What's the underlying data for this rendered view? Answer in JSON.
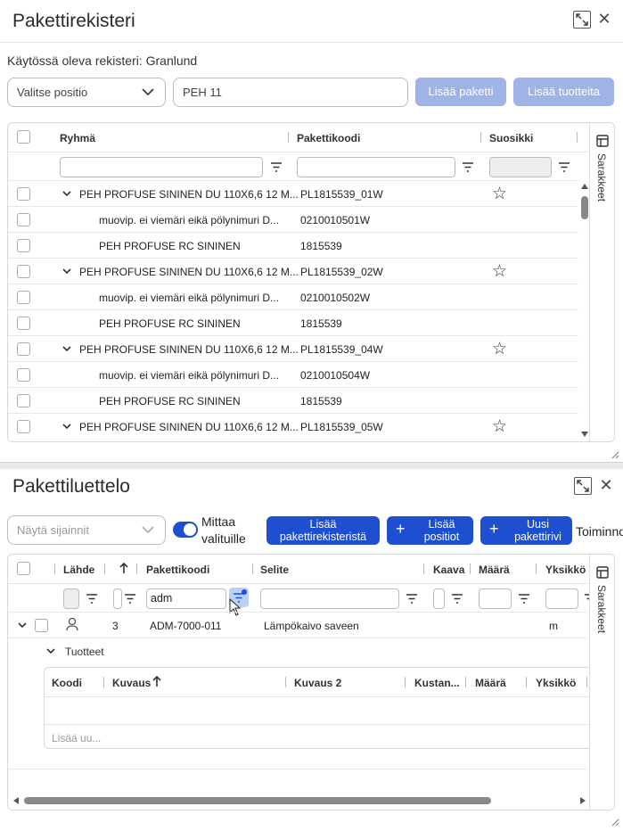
{
  "top_panel": {
    "title": "Pakettirekisteri",
    "register_label": "Käytössä oleva rekisteri: Granlund",
    "position_select_placeholder": "Valitse positio",
    "search_value": "PEH 11",
    "add_package_label": "Lisää paketti",
    "add_products_label": "Lisää tuotteita",
    "side_tab_label": "Sarakkeet",
    "columns": [
      "Ryhmä",
      "Pakettikoodi",
      "Suosikki"
    ],
    "rows": [
      {
        "group": "PEH PROFUSE SININEN DU 110X6,6 12 M...",
        "code": "PL1815539_01W",
        "parent": true
      },
      {
        "group": "muovip. ei viemäri eikä pölynimuri D...",
        "code": "0210010501W",
        "parent": false
      },
      {
        "group": "PEH PROFUSE RC SININEN",
        "code": "1815539",
        "parent": false
      },
      {
        "group": "PEH PROFUSE SININEN DU 110X6,6 12 M...",
        "code": "PL1815539_02W",
        "parent": true
      },
      {
        "group": "muovip. ei viemäri eikä pölynimuri D...",
        "code": "0210010502W",
        "parent": false
      },
      {
        "group": "PEH PROFUSE RC SININEN",
        "code": "1815539",
        "parent": false
      },
      {
        "group": "PEH PROFUSE SININEN DU 110X6,6 12 M...",
        "code": "PL1815539_04W",
        "parent": true
      },
      {
        "group": "muovip. ei viemäri eikä pölynimuri D...",
        "code": "0210010504W",
        "parent": false
      },
      {
        "group": "PEH PROFUSE RC SININEN",
        "code": "1815539",
        "parent": false
      },
      {
        "group": "PEH PROFUSE SININEN DU 110X6,6 12 M...",
        "code": "PL1815539_05W",
        "parent": true
      }
    ]
  },
  "bottom_panel": {
    "title": "Pakettiluettelo",
    "location_select_placeholder": "Näytä sijainnit",
    "toggle_label": "Mittaa valituille",
    "toggle_on": true,
    "add_from_registry_label": "Lisää pakettirekisteristä",
    "add_positions_label": "Lisää positiot",
    "new_row_label": "Uusi pakettirivi",
    "actions_label": "Toiminnot",
    "side_tab_label": "Sarakkeet",
    "columns": [
      "Lähde",
      "Pakettikoodi",
      "Selite",
      "Kaava",
      "Määrä",
      "Yksikkö"
    ],
    "code_filter_value": "adm",
    "row": {
      "number": "3",
      "code": "ADM-7000-011",
      "description": "Lämpökaivo saveen",
      "unit": "m"
    },
    "sub_section_label": "Tuotteet",
    "sub_columns": [
      "Koodi",
      "Kuvaus",
      "Kuvaus 2",
      "Kustan...",
      "Määrä",
      "Yksikkö"
    ],
    "add_row_placeholder": "Lisää uu..."
  }
}
